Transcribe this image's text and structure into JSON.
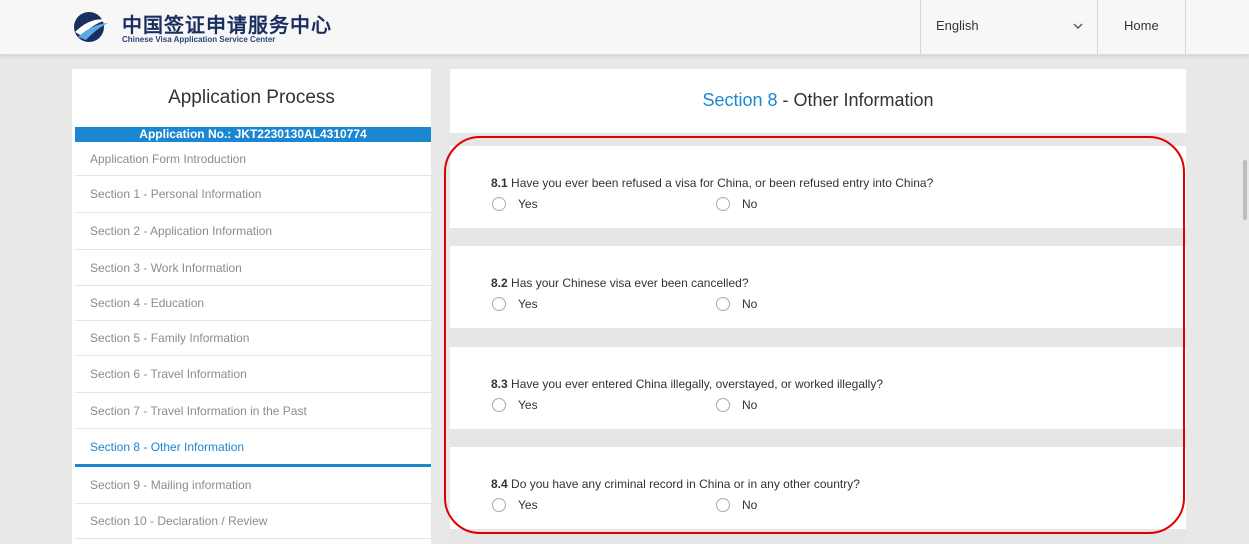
{
  "header": {
    "logo_cn": "中国签证申请服务中心",
    "logo_en": "Chinese Visa Application Service Center",
    "language": "English",
    "home_label": "Home",
    "brand_color": "#1b87d0"
  },
  "sidebar": {
    "title": "Application Process",
    "application_no": "Application No.: JKT2230130AL4310774",
    "items": [
      {
        "label": "Application Form Introduction",
        "active": false
      },
      {
        "label": "Section 1 - Personal Information",
        "active": false
      },
      {
        "label": "Section 2 - Application Information",
        "active": false
      },
      {
        "label": "Section 3 - Work Information",
        "active": false
      },
      {
        "label": "Section 4 - Education",
        "active": false
      },
      {
        "label": "Section 5 - Family Information",
        "active": false
      },
      {
        "label": "Section 6 - Travel Information",
        "active": false
      },
      {
        "label": "Section 7 - Travel Information in the Past",
        "active": false
      },
      {
        "label": "Section 8 - Other Information",
        "active": true
      },
      {
        "label": "Section 9 - Mailing information",
        "active": false
      },
      {
        "label": "Section 10 - Declaration / Review",
        "active": false
      }
    ]
  },
  "main": {
    "section_number": "Section 8",
    "section_title": " - Other Information",
    "questions": [
      {
        "number": "8.1",
        "text": " Have you ever been refused a visa for China, or been refused entry into China?",
        "yes_label": "Yes",
        "no_label": "No",
        "selected": null
      },
      {
        "number": "8.2",
        "text": " Has your Chinese visa ever been cancelled?",
        "yes_label": "Yes",
        "no_label": "No",
        "selected": null
      },
      {
        "number": "8.3",
        "text": " Have you ever entered China illegally, overstayed, or worked illegally?",
        "yes_label": "Yes",
        "no_label": "No",
        "selected": null
      },
      {
        "number": "8.4",
        "text": " Do you have any criminal record in China or in any other country?",
        "yes_label": "Yes",
        "no_label": "No",
        "selected": null
      }
    ]
  }
}
